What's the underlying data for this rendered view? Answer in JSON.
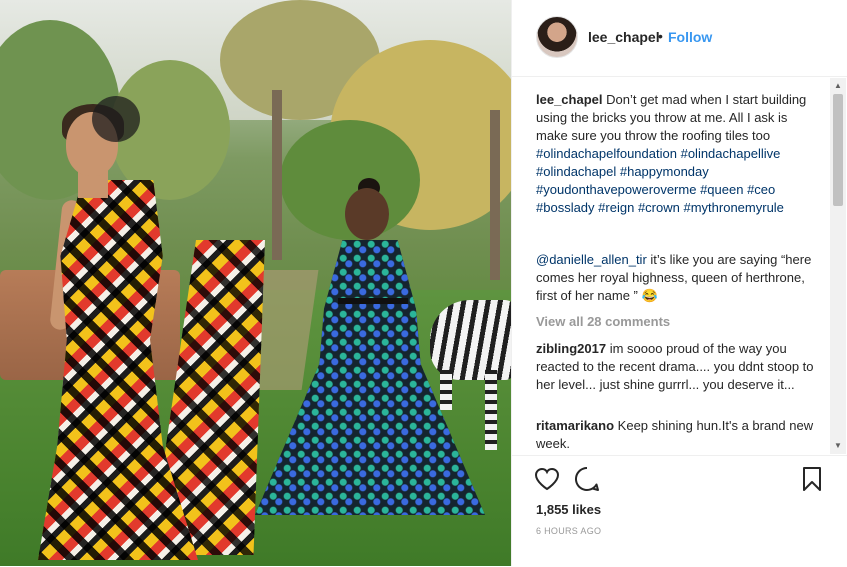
{
  "post": {
    "username": "lee_chapel",
    "separator": "•",
    "follow_label": "Follow",
    "caption": {
      "username": "lee_chapel",
      "text": "Don’t get mad when I start building using the bricks you throw at me. All I ask is make sure you throw the roofing tiles too",
      "hashtags": [
        "#olindachapelfoundation",
        "#olindachapellive",
        "#olindachapel",
        "#happymonday",
        "#youdonthavepoweroverme",
        "#queen",
        "#ceo",
        "#bosslady",
        "#reign",
        "#crown",
        "#mythronemyrule"
      ]
    },
    "reply": {
      "mention": "@danielle_allen_tir",
      "text": "it’s like you are saying “here comes her royal highness, queen of herthrone, first of her name ” 😂"
    },
    "view_all_comments": "View all 28 comments",
    "comments": [
      {
        "username": "zibling2017",
        "text": "im soooo proud of the way you reacted to the recent drama.... you ddnt stoop to her level... just shine gurrrl... you deserve it..."
      },
      {
        "username": "ritamarikano",
        "text": "Keep shining hun.It's a brand new week."
      }
    ],
    "likes": "1,855 likes",
    "time_ago": "6 HOURS AGO"
  },
  "icons": {
    "like": "heart-icon",
    "comment": "comment-bubble-icon",
    "save": "bookmark-icon",
    "scroll_up": "scroll-up-arrow-icon",
    "scroll_down": "scroll-down-arrow-icon"
  },
  "colors": {
    "link": "#3897f0",
    "hashtag": "#003569",
    "muted": "#999999",
    "text": "#262626",
    "border": "#efefef"
  }
}
